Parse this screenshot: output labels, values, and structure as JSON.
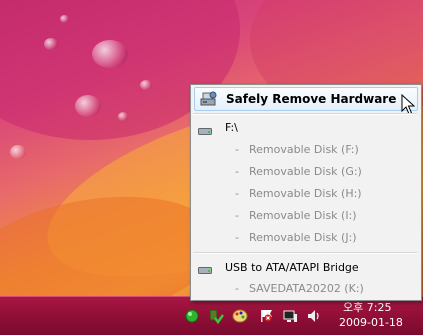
{
  "menu": {
    "header_label": "Safely Remove Hardware",
    "groups": [
      {
        "device": "F:\\",
        "volumes": [
          "Removable Disk (F:)",
          "Removable Disk (G:)",
          "Removable Disk (H:)",
          "Removable Disk (I:)",
          "Removable Disk (J:)"
        ]
      },
      {
        "device": "USB to ATA/ATAPI Bridge",
        "volumes": [
          "SAVEDATA20202 (K:)"
        ]
      }
    ],
    "volume_dash": "-"
  },
  "clock": {
    "time": "오후 7:25",
    "date": "2009-01-18"
  },
  "tray_icons": [
    "network-status-icon",
    "safely-remove-hardware-icon",
    "paint-palette-icon",
    "action-center-flag-icon",
    "network-icon",
    "volume-icon"
  ],
  "colors": {
    "taskbar": "#8e0e36",
    "menu_bg": "#f2f2f2",
    "header_highlight": "#e3f0fc",
    "disabled_text": "#8a8a8a"
  }
}
